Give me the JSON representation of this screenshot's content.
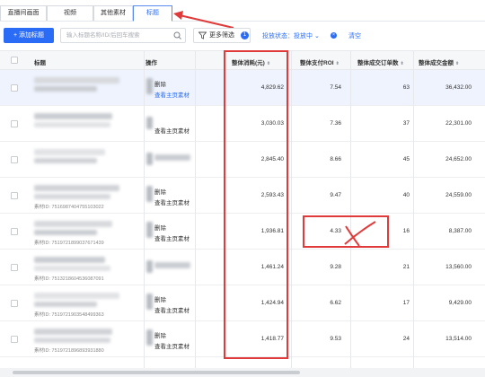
{
  "tabs": [
    {
      "label": "直播间画面",
      "active": false
    },
    {
      "label": "视频",
      "active": false
    },
    {
      "label": "其他素材",
      "active": false
    },
    {
      "label": "标题",
      "active": true
    }
  ],
  "toolbar": {
    "add_label": "+ 添加标题",
    "search_placeholder": "输入标题名称/ID/后回车搜索",
    "filter_label": "更多筛选",
    "filter_count": "1",
    "status_label": "投放状态：投放中",
    "clear_label": "清空"
  },
  "table": {
    "headers": {
      "title": "标题",
      "operation": "操作",
      "cost": "整体消耗(元)",
      "roi": "整体支付ROI",
      "orders": "整体成交订单数",
      "amount": "整体成交金额"
    },
    "rows": [
      {
        "id_text": "",
        "ops": [
          "删除",
          "查看主页素材"
        ],
        "cost": "4,829.62",
        "roi": "7.54",
        "orders": "63",
        "amount": "36,432.00",
        "highlight": true
      },
      {
        "id_text": "",
        "ops": [
          "",
          "查看主页素材"
        ],
        "cost": "3,030.03",
        "roi": "7.36",
        "orders": "37",
        "amount": "22,301.00",
        "highlight": false
      },
      {
        "id_text": "",
        "ops": [
          "",
          ""
        ],
        "cost": "2,845.40",
        "roi": "8.66",
        "orders": "45",
        "amount": "24,652.00",
        "highlight": false
      },
      {
        "id_text": "素材ID: 7516987404755103022",
        "ops": [
          "删除",
          "查看主页素材"
        ],
        "cost": "2,593.43",
        "roi": "9.47",
        "orders": "40",
        "amount": "24,559.00",
        "highlight": false
      },
      {
        "id_text": "素材ID: 7519721899037671439",
        "ops": [
          "删除",
          "查看主页素材"
        ],
        "cost": "1,936.81",
        "roi": "4.33",
        "orders": "16",
        "amount": "8,387.00",
        "highlight": false
      },
      {
        "id_text": "素材ID: 7513218604536087091",
        "ops": [
          "",
          ""
        ],
        "cost": "1,461.24",
        "roi": "9.28",
        "orders": "21",
        "amount": "13,560.00",
        "highlight": false
      },
      {
        "id_text": "素材ID: 7519721903548499363",
        "ops": [
          "删除",
          "查看主页素材"
        ],
        "cost": "1,424.94",
        "roi": "6.62",
        "orders": "17",
        "amount": "9,429.00",
        "highlight": false
      },
      {
        "id_text": "素材ID: 7519721896893931880",
        "ops": [
          "删除",
          "查看主页素材"
        ],
        "cost": "1,418.77",
        "roi": "9.53",
        "orders": "24",
        "amount": "13,514.00",
        "highlight": false
      }
    ]
  },
  "colors": {
    "accent": "#2b6cf6",
    "annotation_red": "#e03a3a",
    "row_highlight": "#eef3fd"
  }
}
